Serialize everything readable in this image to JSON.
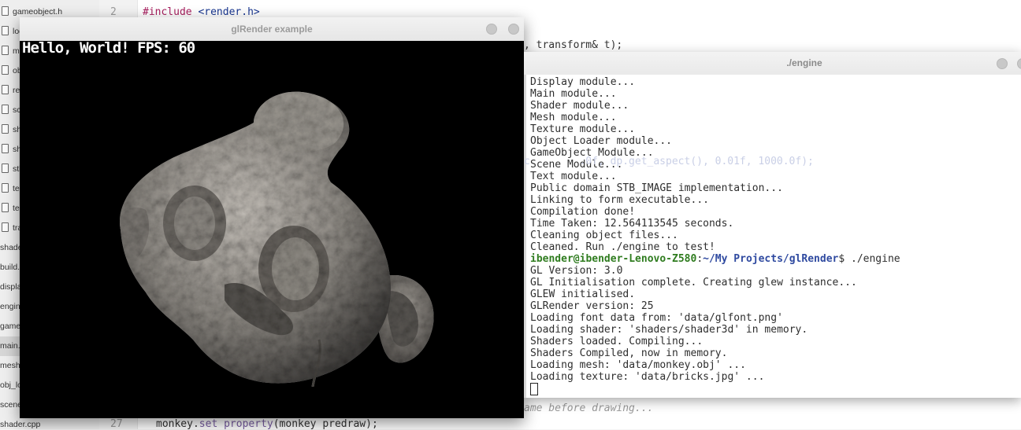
{
  "sidebar": {
    "items": [
      {
        "label": "gameobject.h",
        "icon": "file-icon"
      },
      {
        "label": "logger.h",
        "icon": "file-icon"
      },
      {
        "label": "me",
        "icon": "file-icon"
      },
      {
        "label": "ob",
        "icon": "file-icon"
      },
      {
        "label": "ren",
        "icon": "file-icon"
      },
      {
        "label": "sce",
        "icon": "file-icon"
      },
      {
        "label": "sh",
        "icon": "file-icon"
      },
      {
        "label": "sh",
        "icon": "file-icon"
      },
      {
        "label": "stb",
        "icon": "file-icon"
      },
      {
        "label": "tex",
        "icon": "file-icon"
      },
      {
        "label": "tex",
        "icon": "file-icon"
      },
      {
        "label": "tra",
        "icon": "file-icon"
      },
      {
        "label": "shade"
      },
      {
        "label": "build.s"
      },
      {
        "label": "displa"
      },
      {
        "label": "engine"
      },
      {
        "label": "gameo"
      },
      {
        "label": "main.",
        "active": true
      },
      {
        "label": "mesh."
      },
      {
        "label": "obj_lo"
      },
      {
        "label": "scene"
      },
      {
        "label": "shader.cpp"
      }
    ]
  },
  "editor": {
    "line_numbers": {
      "first": "2",
      "last": "27"
    },
    "line2": {
      "kw": "#include",
      "str": " <render.h>"
    },
    "line3_tail": ", transform& t);",
    "line_comment_fragment": "ame before drawing...",
    "line27": {
      "obj": "monkey.",
      "fn": "set property",
      "rest": "(monkey predraw);"
    },
    "bg_fragment_e": "e"
  },
  "gl_window": {
    "title": "glRender example",
    "hud_text": "Hello, World! FPS: 60"
  },
  "terminal": {
    "title": "./engine",
    "faint_code": "c        .0f, dp.get_aspect(), 0.01f, 1000.0f);",
    "lines_before": [
      "Display module...",
      "Main module...",
      "Shader module...",
      "Mesh module...",
      "Texture module...",
      "Object Loader module...",
      "GameObject Module...",
      "Scene Module...",
      "Text module...",
      "Public domain STB_IMAGE implementation...",
      "Linking to form executable...",
      "Compilation done!",
      "Time Taken: 12.564113545 seconds.",
      "Cleaning object files...",
      "Cleaned. Run ./engine to test!"
    ],
    "prompt": {
      "user": "ibender@ibender-Lenovo-Z580",
      "sep": ":",
      "path": "~/My Projects/glRender",
      "cmd": "$ ./engine"
    },
    "lines_after": [
      "GL Version: 3.0",
      "GL Initialisation complete. Creating glew instance...",
      "GLEW initialised.",
      "GLRender version: 25",
      "Loading font data from: 'data/glfont.png'",
      "Loading shader: 'shaders/shader3d' in memory.",
      "Shaders loaded. Compiling...",
      "Shaders Compiled, now in memory.",
      "Loading mesh: 'data/monkey.obj' ...",
      "Loading texture: 'data/bricks.jpg' ..."
    ]
  },
  "colors": {
    "keyword": "#a71d5d",
    "string": "#183691",
    "prompt_user": "#2f7c1f",
    "prompt_path": "#2f4aa0"
  }
}
